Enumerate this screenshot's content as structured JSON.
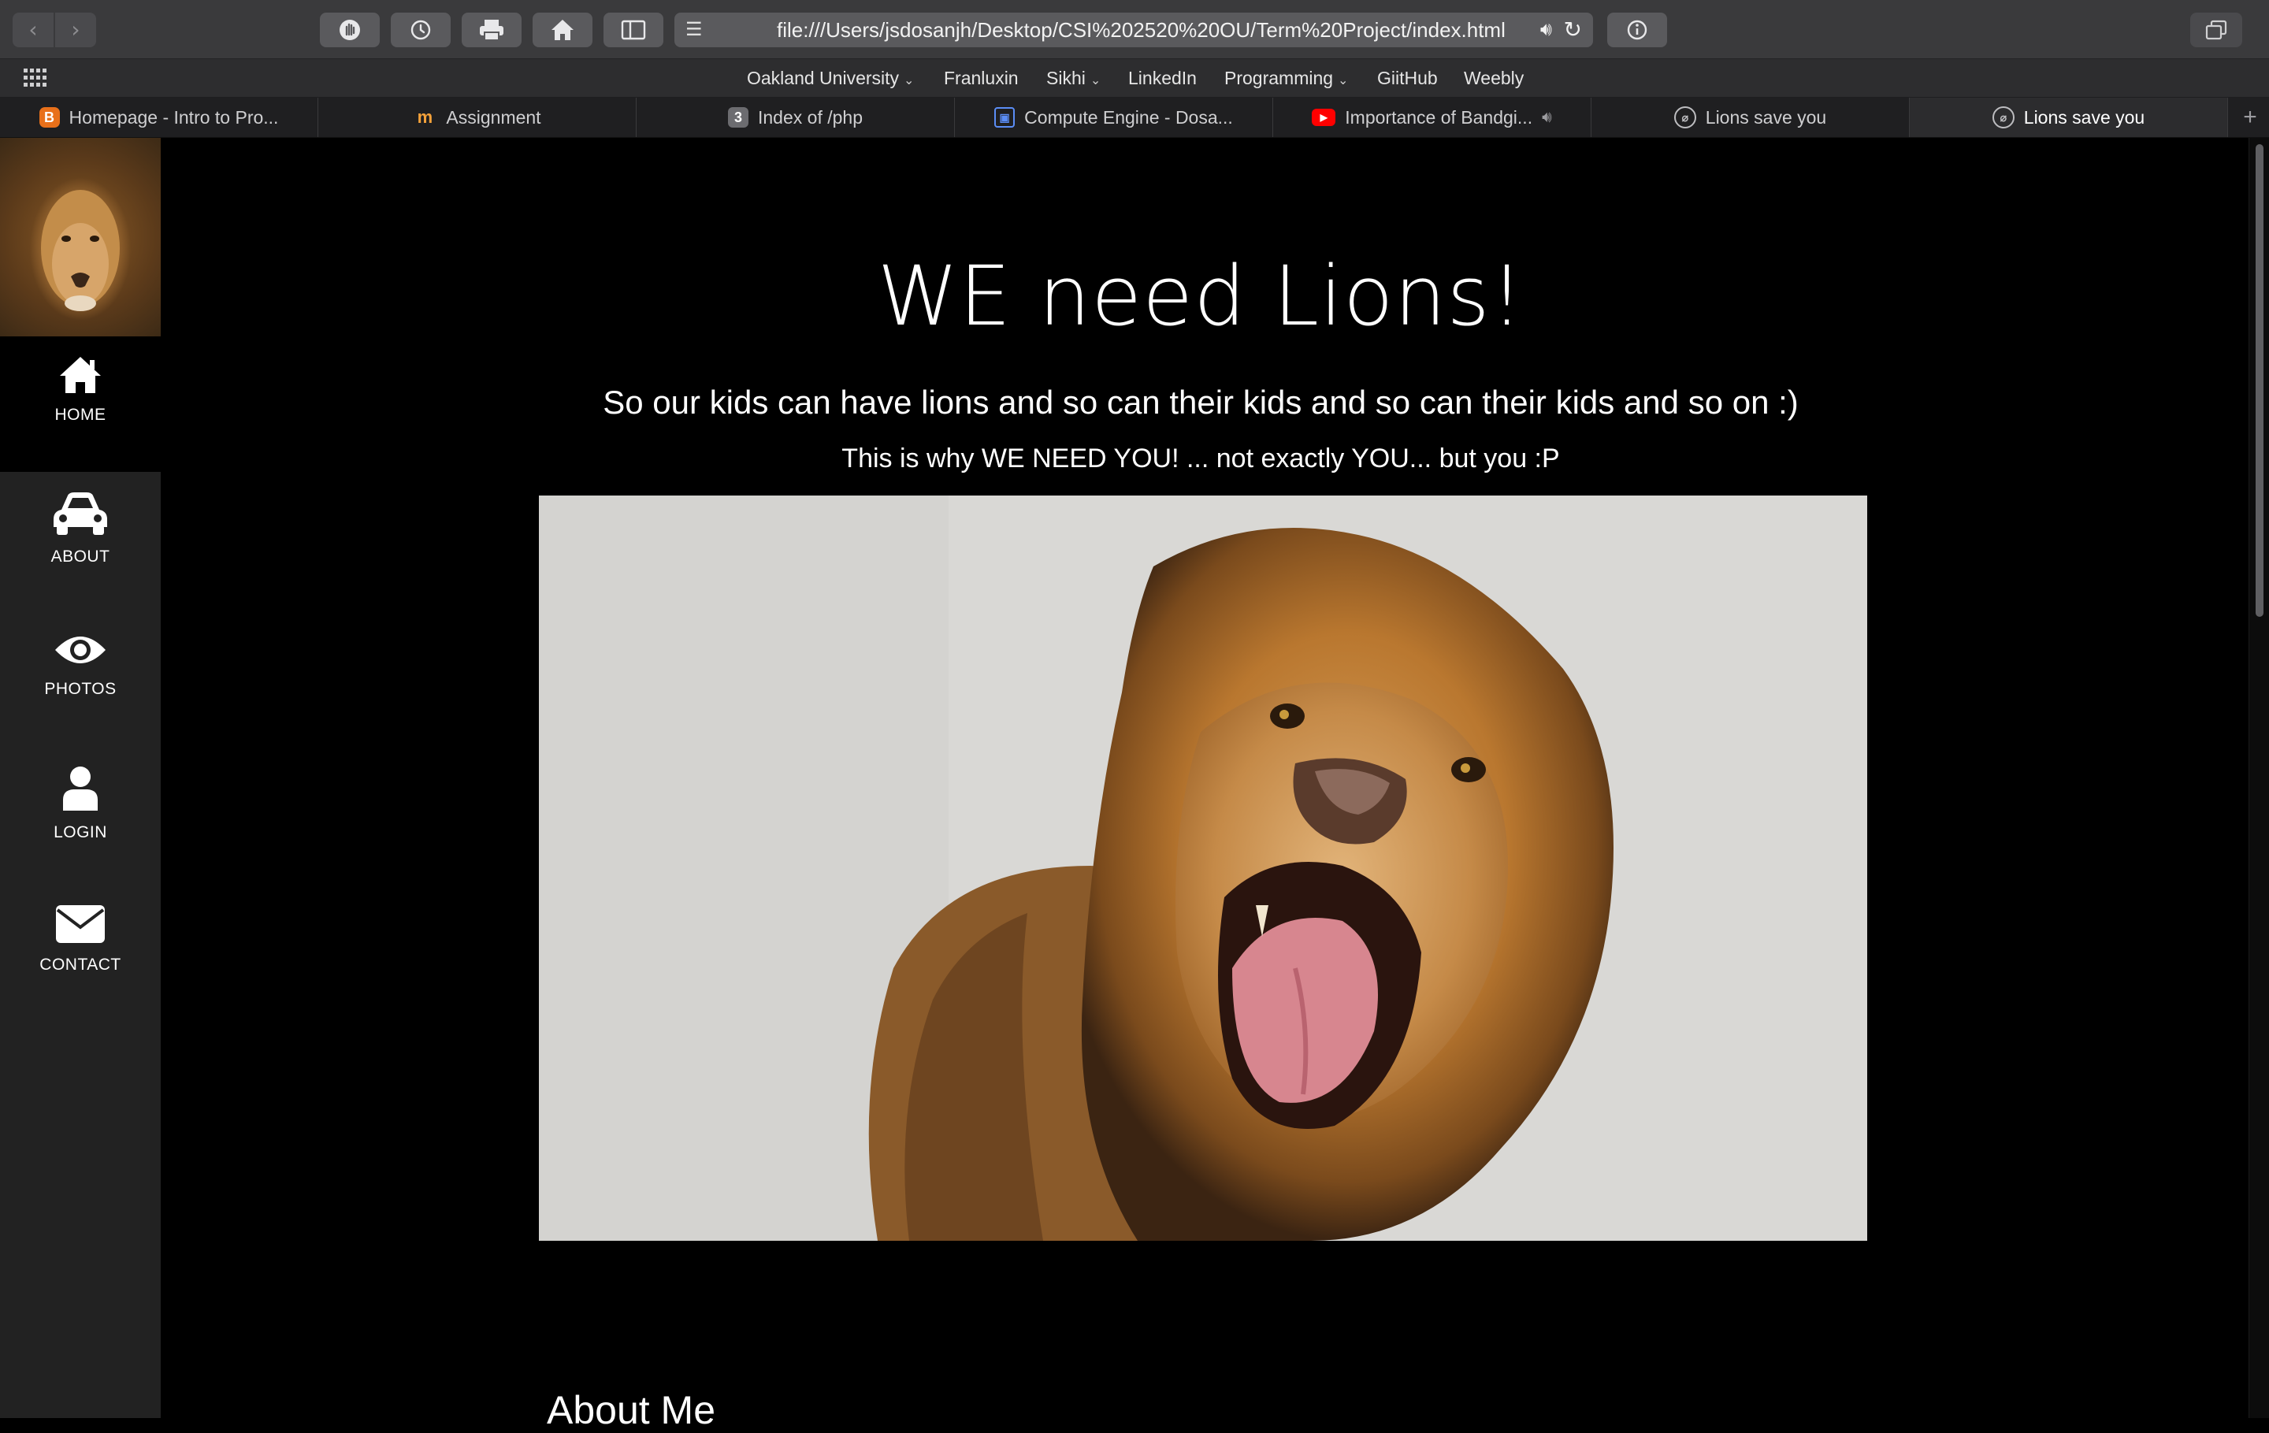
{
  "browser": {
    "url": "file:///Users/jsdosanjh/Desktop/CSI%202520%20OU/Term%20Project/index.html"
  },
  "favorites": [
    {
      "label": "Oakland University",
      "has_menu": true
    },
    {
      "label": "Franluxin",
      "has_menu": false
    },
    {
      "label": "Sikhi",
      "has_menu": true
    },
    {
      "label": "LinkedIn",
      "has_menu": false
    },
    {
      "label": "Programming",
      "has_menu": true
    },
    {
      "label": "GiitHub",
      "has_menu": false
    },
    {
      "label": "Weebly",
      "has_menu": false
    }
  ],
  "tabs": [
    {
      "label": "Homepage - Intro to Pro...",
      "icon": "blogger-icon",
      "icon_text": "B"
    },
    {
      "label": "Assignment",
      "icon": "moodle-icon",
      "icon_text": "m"
    },
    {
      "label": "Index of /php",
      "icon": "number-icon",
      "icon_text": "3"
    },
    {
      "label": "Compute Engine - Dosa...",
      "icon": "compute-engine-icon",
      "icon_text": "▣"
    },
    {
      "label": "Importance of Bandgi...",
      "icon": "youtube-icon",
      "icon_text": "▶"
    },
    {
      "label": "Lions save you",
      "icon": "compass-icon",
      "icon_text": "⌀"
    },
    {
      "label": "Lions save you",
      "icon": "compass-icon",
      "icon_text": "⌀"
    }
  ],
  "sidebar": {
    "items": [
      {
        "label": "HOME",
        "icon": "home-icon"
      },
      {
        "label": "ABOUT",
        "icon": "car-icon"
      },
      {
        "label": "PHOTOS",
        "icon": "eye-icon"
      },
      {
        "label": "LOGIN",
        "icon": "user-icon"
      },
      {
        "label": "CONTACT",
        "icon": "envelope-icon"
      }
    ],
    "active": "HOME"
  },
  "main": {
    "headline": "WE need Lions!",
    "subline1": "So our kids can have lions and so can their kids and so can their kids and so on :)",
    "subline2": "This is why WE NEED YOU! ... not exactly YOU... but you :P",
    "about_heading": "About Me"
  },
  "colors": {
    "page_background": "#000000",
    "sidebar_background": "#222222",
    "active_nav_background": "#000000",
    "text": "#ffffff"
  }
}
